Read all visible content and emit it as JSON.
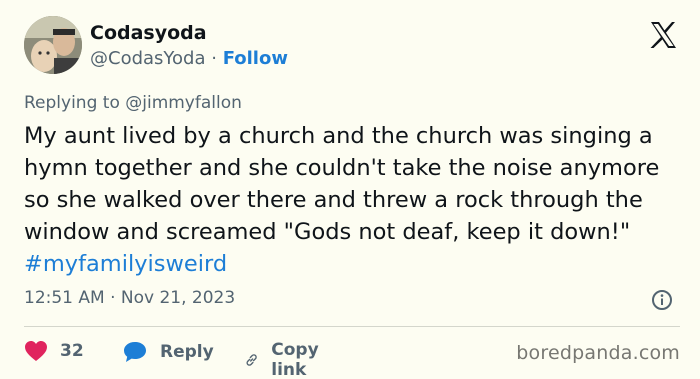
{
  "user": {
    "display_name": "Codasyoda",
    "handle": "@CodasYoda",
    "separator": "·",
    "follow_label": "Follow"
  },
  "tweet": {
    "replying_to": "Replying to @jimmyfallon",
    "text": "My aunt lived by a church and the church was singing a hymn together and she couldn't take the noise anymore so she walked over there and threw a rock through the window and screamed \"Gods not deaf, keep it down!\" ",
    "hashtag": "#myfamilyisweird",
    "timestamp": "12:51 AM · Nov 21, 2023"
  },
  "actions": {
    "likes_count": "32",
    "reply_label": "Reply",
    "copy_link_label": "Copy link"
  },
  "watermark": "boredpanda.com",
  "colors": {
    "background": "#fdfdf2",
    "link": "#1d7ed6",
    "heart": "#e0245e",
    "reply_bubble": "#1d7ed6",
    "secondary_text": "#536471"
  },
  "icons": [
    "x-logo-icon",
    "info-icon",
    "heart-icon",
    "reply-bubble-icon",
    "link-icon"
  ]
}
